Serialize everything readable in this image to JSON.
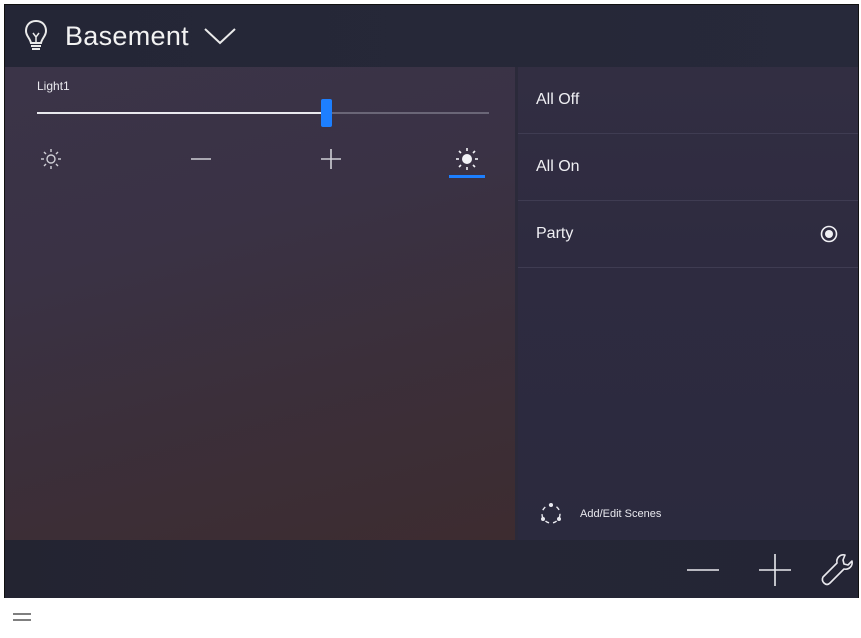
{
  "header": {
    "room_name": "Basement",
    "icons": {
      "bulb": "lightbulb-icon",
      "dropdown": "chevron-down-icon"
    }
  },
  "light": {
    "label": "Light1",
    "level_fraction": 0.64,
    "controls": [
      {
        "name": "dim-low-icon"
      },
      {
        "name": "minus-icon"
      },
      {
        "name": "plus-icon"
      },
      {
        "name": "bright-high-icon",
        "active": true
      }
    ]
  },
  "scenes": {
    "items": [
      {
        "label": "All Off",
        "selected": false
      },
      {
        "label": "All On",
        "selected": false
      },
      {
        "label": "Party",
        "selected": true
      }
    ],
    "add_edit_label": "Add/Edit Scenes"
  },
  "bottom_bar": {
    "icons": [
      "minus-icon",
      "plus-icon",
      "wrench-icon"
    ]
  },
  "colors": {
    "accent": "#1d7fff",
    "background": "#2b2a3a"
  }
}
